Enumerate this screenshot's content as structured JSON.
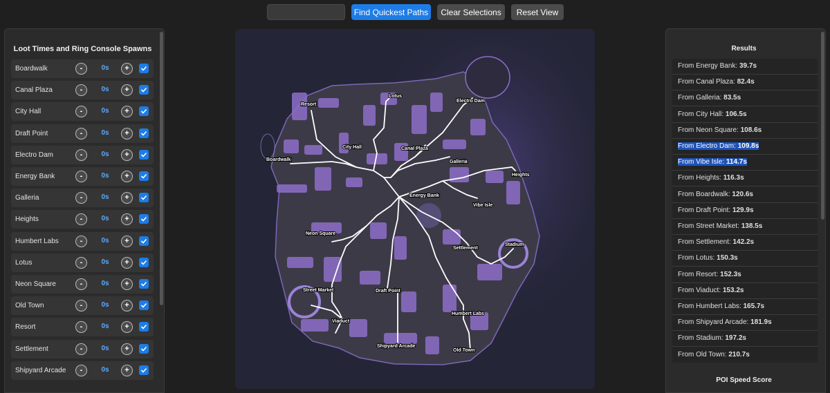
{
  "toolbar": {
    "search_value": "",
    "find_label": "Find Quickest Paths",
    "clear_label": "Clear Selections",
    "reset_label": "Reset View"
  },
  "left_panel": {
    "title": "Loot Times and Ring Console Spawns",
    "minus_glyph": "-",
    "plus_glyph": "+",
    "items": [
      {
        "name": "Boardwalk",
        "time": "0s",
        "checked": true
      },
      {
        "name": "Canal Plaza",
        "time": "0s",
        "checked": true
      },
      {
        "name": "City Hall",
        "time": "0s",
        "checked": true
      },
      {
        "name": "Draft Point",
        "time": "0s",
        "checked": true
      },
      {
        "name": "Electro Dam",
        "time": "0s",
        "checked": true
      },
      {
        "name": "Energy Bank",
        "time": "0s",
        "checked": true
      },
      {
        "name": "Galleria",
        "time": "0s",
        "checked": true
      },
      {
        "name": "Heights",
        "time": "0s",
        "checked": true
      },
      {
        "name": "Humbert Labs",
        "time": "0s",
        "checked": true
      },
      {
        "name": "Lotus",
        "time": "0s",
        "checked": true
      },
      {
        "name": "Neon Square",
        "time": "0s",
        "checked": true
      },
      {
        "name": "Old Town",
        "time": "0s",
        "checked": true
      },
      {
        "name": "Resort",
        "time": "0s",
        "checked": true
      },
      {
        "name": "Settlement",
        "time": "0s",
        "checked": true
      },
      {
        "name": "Shipyard Arcade",
        "time": "0s",
        "checked": true
      }
    ]
  },
  "map": {
    "labels": [
      "Resort",
      "Lotus",
      "Electro Dam",
      "City Hall",
      "Canal Plaza",
      "Boardwalk",
      "Galleria",
      "Heights",
      "Energy Bank",
      "Vibe Isle",
      "Neon Square",
      "Settlement",
      "Stadium",
      "Street Market",
      "Draft Point",
      "Viaduct",
      "Humbert Labs",
      "Shipyard Arcade",
      "Old Town"
    ],
    "colors": {
      "land": "#3d3a47",
      "building": "#8d6fc9",
      "path": "#ffffff",
      "water": "#242536"
    }
  },
  "results": {
    "title": "Results",
    "footer": "POI Speed Score",
    "prefix": "From",
    "items": [
      {
        "name": "Energy Bank",
        "time": "39.7s",
        "selected": false
      },
      {
        "name": "Canal Plaza",
        "time": "82.4s",
        "selected": false
      },
      {
        "name": "Galleria",
        "time": "83.5s",
        "selected": false
      },
      {
        "name": "City Hall",
        "time": "106.5s",
        "selected": false
      },
      {
        "name": "Neon Square",
        "time": "108.6s",
        "selected": false
      },
      {
        "name": "Electro Dam",
        "time": "109.8s",
        "selected": true
      },
      {
        "name": "Vibe Isle",
        "time": "114.7s",
        "selected": true
      },
      {
        "name": "Heights",
        "time": "116.3s",
        "selected": false
      },
      {
        "name": "Boardwalk",
        "time": "120.6s",
        "selected": false
      },
      {
        "name": "Draft Point",
        "time": "129.9s",
        "selected": false
      },
      {
        "name": "Street Market",
        "time": "138.5s",
        "selected": false
      },
      {
        "name": "Settlement",
        "time": "142.2s",
        "selected": false
      },
      {
        "name": "Lotus",
        "time": "150.3s",
        "selected": false
      },
      {
        "name": "Resort",
        "time": "152.3s",
        "selected": false
      },
      {
        "name": "Viaduct",
        "time": "153.2s",
        "selected": false
      },
      {
        "name": "Humbert Labs",
        "time": "165.7s",
        "selected": false
      },
      {
        "name": "Shipyard Arcade",
        "time": "181.9s",
        "selected": false
      },
      {
        "name": "Stadium",
        "time": "197.2s",
        "selected": false
      },
      {
        "name": "Old Town",
        "time": "210.7s",
        "selected": false
      }
    ]
  }
}
